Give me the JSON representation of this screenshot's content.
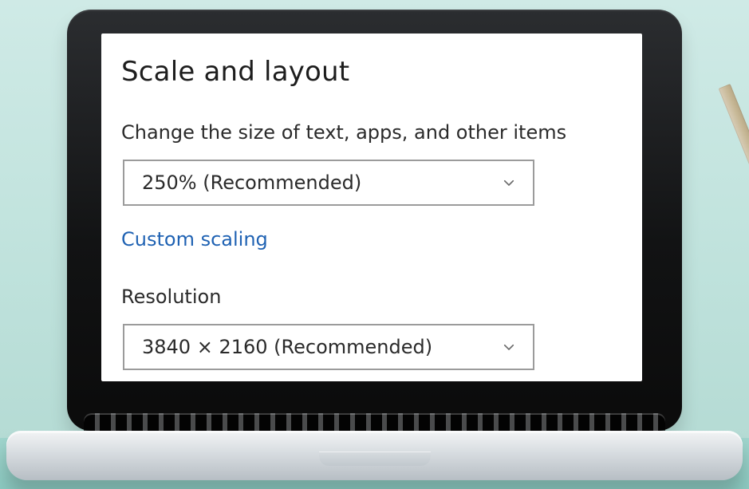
{
  "settings": {
    "title": "Scale and layout",
    "scale_label": "Change the size of text, apps, and other items",
    "scale_value": "250% (Recommended)",
    "custom_scaling_link": "Custom scaling",
    "resolution_label": "Resolution",
    "resolution_value": "3840 × 2160 (Recommended)"
  },
  "icons": {
    "dropdown_chevron": "chevron-down-icon"
  }
}
